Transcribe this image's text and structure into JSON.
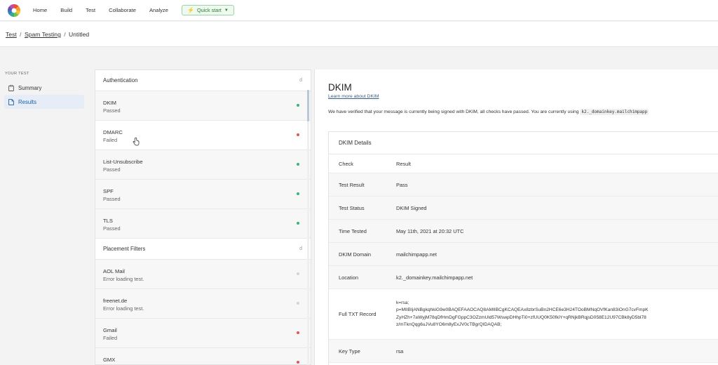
{
  "nav": {
    "items": [
      "Home",
      "Build",
      "Test",
      "Collaborate",
      "Analyze"
    ],
    "quick_start": "Quick start"
  },
  "breadcrumb": {
    "test": "Test",
    "spam_testing": "Spam Testing",
    "current": "Untitled",
    "sep": "/"
  },
  "sidebar": {
    "heading": "YOUR TEST",
    "items": [
      {
        "label": "Summary",
        "icon": "clipboard-icon"
      },
      {
        "label": "Results",
        "icon": "document-icon"
      }
    ]
  },
  "list": {
    "authentication_title": "Authentication",
    "placement_title": "Placement Filters",
    "section_glyph": "d",
    "authentication": [
      {
        "name": "DKIM",
        "status": "Passed",
        "state": "green"
      },
      {
        "name": "DMARC",
        "status": "Failed",
        "state": "red"
      },
      {
        "name": "List-Unsubscribe",
        "status": "Passed",
        "state": "green"
      },
      {
        "name": "SPF",
        "status": "Passed",
        "state": "green"
      },
      {
        "name": "TLS",
        "status": "Passed",
        "state": "green"
      }
    ],
    "placement": [
      {
        "name": "AOL Mail",
        "status": "Error loading test.",
        "state": "gray"
      },
      {
        "name": "freenet.de",
        "status": "Error loading test.",
        "state": "gray"
      },
      {
        "name": "Gmail",
        "status": "Failed",
        "state": "red"
      },
      {
        "name": "GMX",
        "status": "",
        "state": "red"
      }
    ]
  },
  "detail": {
    "title": "DKIM",
    "learn_more": "Learn more about DKIM",
    "description": "We have verified that your message is currently being signed with DKIM, all checks have passed. You are currently using",
    "selector": "k2._domainkey.mailchimpapp",
    "card_title": "DKIM Details",
    "header": {
      "check": "Check",
      "result": "Result"
    },
    "rows": [
      {
        "check": "Test Result",
        "result": "Pass"
      },
      {
        "check": "Test Status",
        "result": "DKIM Signed"
      },
      {
        "check": "Time Tested",
        "result": "May 11th, 2021 at 20:32 UTC"
      },
      {
        "check": "DKIM Domain",
        "result": "mailchimpapp.net"
      },
      {
        "check": "Location",
        "result": "k2._domainkey.mailchimpapp.net"
      }
    ],
    "txt_record": {
      "check": "Full TXT Record",
      "lines": [
        "k=rsa;",
        "p=MIIBIjANBgkqhkiG9w0BAQEFAAOCAQ8AMIIBCgKCAQEAx8zbrSuBn2HCE6e3H24TOoBMNqOVfKan83iOnG7cvFmpK",
        "ZyHZh+7aWyjM78qDfHmDgFGppC3OZzmUld57WswpDHhpTi0+zfUUQ0K50fkiY+qRNjkBRqjsD058E12U97CBk8yD5bl78",
        "z/mTknQqg6uJVu8YO6m8yExJV0cTBgrQIDAQAB;"
      ]
    },
    "key_type": {
      "check": "Key Type",
      "result": "rsa"
    }
  },
  "colors": {
    "pass": "#3cb37a",
    "fail": "#e05757",
    "neutral": "#d4d4d4",
    "accent": "#1f5fa5",
    "quick_start": "#2e7d32"
  }
}
